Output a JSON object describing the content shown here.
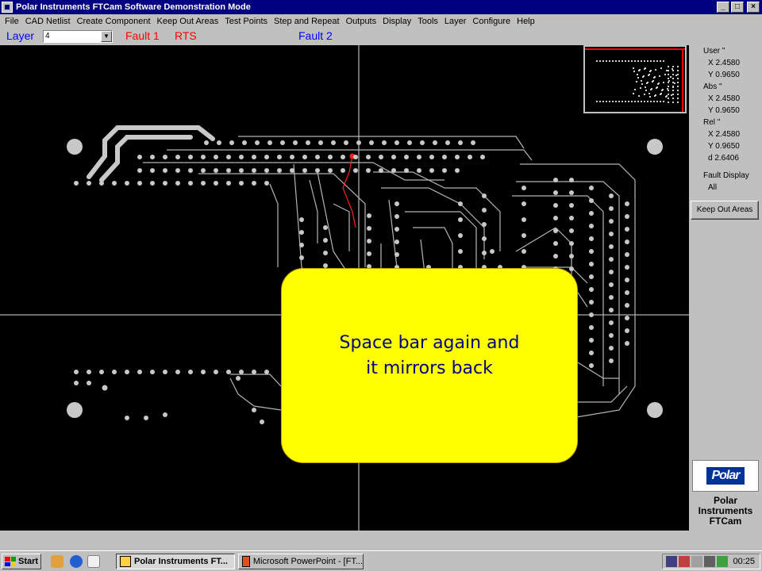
{
  "window": {
    "title": "Polar Instruments FTCam Software  Demonstration Mode",
    "min": "_",
    "max": "□",
    "close": "×"
  },
  "menu": [
    "File",
    "CAD Netlist",
    "Create Component",
    "Keep Out Areas",
    "Test Points",
    "Step and Repeat",
    "Outputs",
    "Display",
    "Tools",
    "Layer",
    "Configure",
    "Help"
  ],
  "toolbar": {
    "layer_label": "Layer",
    "layer_value": "4",
    "fault1": "Fault 1",
    "rts": "RTS",
    "fault2": "Fault 2"
  },
  "callout": {
    "line1": "Space bar again and",
    "line2": "it mirrors back"
  },
  "coords": {
    "user_label": "User \"",
    "user_x": "X 2.4580",
    "user_y": "Y 0.9650",
    "abs_label": "Abs \"",
    "abs_x": "X 2.4580",
    "abs_y": "Y 0.9650",
    "rel_label": "Rel \"",
    "rel_x": "X 2.4580",
    "rel_y": "Y 0.9650",
    "rel_d": "d 2.6406",
    "fault_display_label": "Fault Display",
    "fault_display_value": "All"
  },
  "keep_out_button": "Keep Out Areas",
  "brand": {
    "logo": "Polar",
    "line1": "Polar",
    "line2": "Instruments",
    "line3": "FTCam"
  },
  "taskbar": {
    "start": "Start",
    "task1": "Polar Instruments FT...",
    "task2": "Microsoft PowerPoint - [FT...",
    "clock": "00:25"
  },
  "colors": {
    "accent": "#000080",
    "fault_red": "#ff0000",
    "fault_blue": "#0000ff",
    "callout": "#ffff00"
  }
}
